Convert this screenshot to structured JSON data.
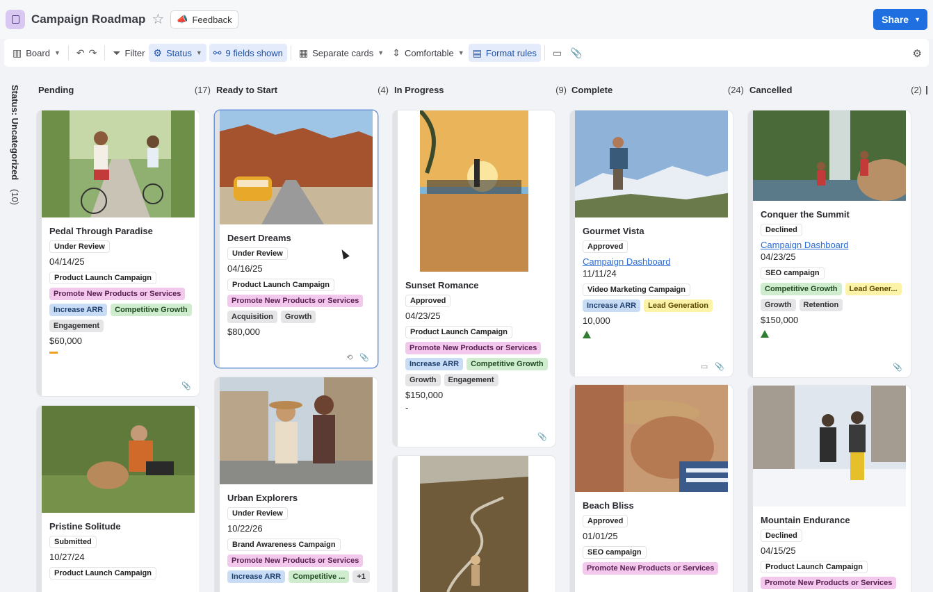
{
  "header": {
    "title": "Campaign Roadmap",
    "feedback_label": "Feedback",
    "share_label": "Share"
  },
  "toolbar": {
    "board": "Board",
    "filter": "Filter",
    "status": "Status",
    "fields": "9 fields shown",
    "separate": "Separate cards",
    "density": "Comfortable",
    "format": "Format rules"
  },
  "sidebar": {
    "group_label": "Status: Uncategorized",
    "group_count": "(10)"
  },
  "columns": [
    {
      "title": "Pending",
      "count": "(17)",
      "cards": [
        {
          "title": "Pedal Through Paradise",
          "status": "Under Review",
          "date": "04/14/25",
          "campaign": "Product Launch Campaign",
          "goal": "Promote New Products or Services",
          "tag1": "Increase ARR",
          "tag2": "Competitive Growth",
          "tag3": "Engagement",
          "amount": "$60,000"
        },
        {
          "title": "Pristine Solitude",
          "status": "Submitted",
          "date": "10/27/24",
          "campaign": "Product Launch Campaign"
        }
      ]
    },
    {
      "title": "Ready to Start",
      "count": "(4)",
      "cards": [
        {
          "title": "Desert Dreams",
          "status": "Under Review",
          "date": "04/16/25",
          "campaign": "Product Launch Campaign",
          "goal": "Promote New Products or Services",
          "tag1": "Acquisition",
          "tag2": "Growth",
          "amount": "$80,000"
        },
        {
          "title": "Urban Explorers",
          "status": "Under Review",
          "date": "10/22/26",
          "campaign": "Brand Awareness Campaign",
          "goal": "Promote New Products or Services",
          "tag1": "Increase ARR",
          "tag2": "Competitive ...",
          "more": "+1"
        }
      ]
    },
    {
      "title": "In Progress",
      "count": "(9)",
      "cards": [
        {
          "title": "Sunset Romance",
          "status": "Approved",
          "date": "04/23/25",
          "campaign": "Product Launch Campaign",
          "goal": "Promote New Products or Services",
          "tag1": "Increase ARR",
          "tag2": "Competitive Growth",
          "tag3": "Growth",
          "tag4": "Engagement",
          "amount": "$150,000",
          "extra": "-"
        }
      ]
    },
    {
      "title": "Complete",
      "count": "(24)",
      "cards": [
        {
          "title": "Gourmet Vista",
          "status": "Approved",
          "link": "Campaign Dashboard",
          "date": "11/11/24",
          "campaign": "Video Marketing Campaign",
          "tag1": "Increase ARR",
          "tag2": "Lead Generation",
          "amount": "10,000"
        },
        {
          "title": "Beach Bliss",
          "status": "Approved",
          "date": "01/01/25",
          "campaign": "SEO campaign",
          "goal": "Promote New Products or Services"
        }
      ]
    },
    {
      "title": "Cancelled",
      "count": "(2)",
      "cards": [
        {
          "title": "Conquer the Summit",
          "status": "Declined",
          "link": "Campaign Dashboard",
          "date": "04/23/25",
          "campaign": "SEO campaign",
          "tag1": "Competitive Growth",
          "tag2": "Lead Gener...",
          "tag3": "Growth",
          "tag4": "Retention",
          "amount": "$150,000"
        },
        {
          "title": "Mountain Endurance",
          "status": "Declined",
          "date": "04/15/25",
          "campaign": "Product Launch Campaign",
          "goal": "Promote New Products or Services"
        }
      ]
    }
  ]
}
